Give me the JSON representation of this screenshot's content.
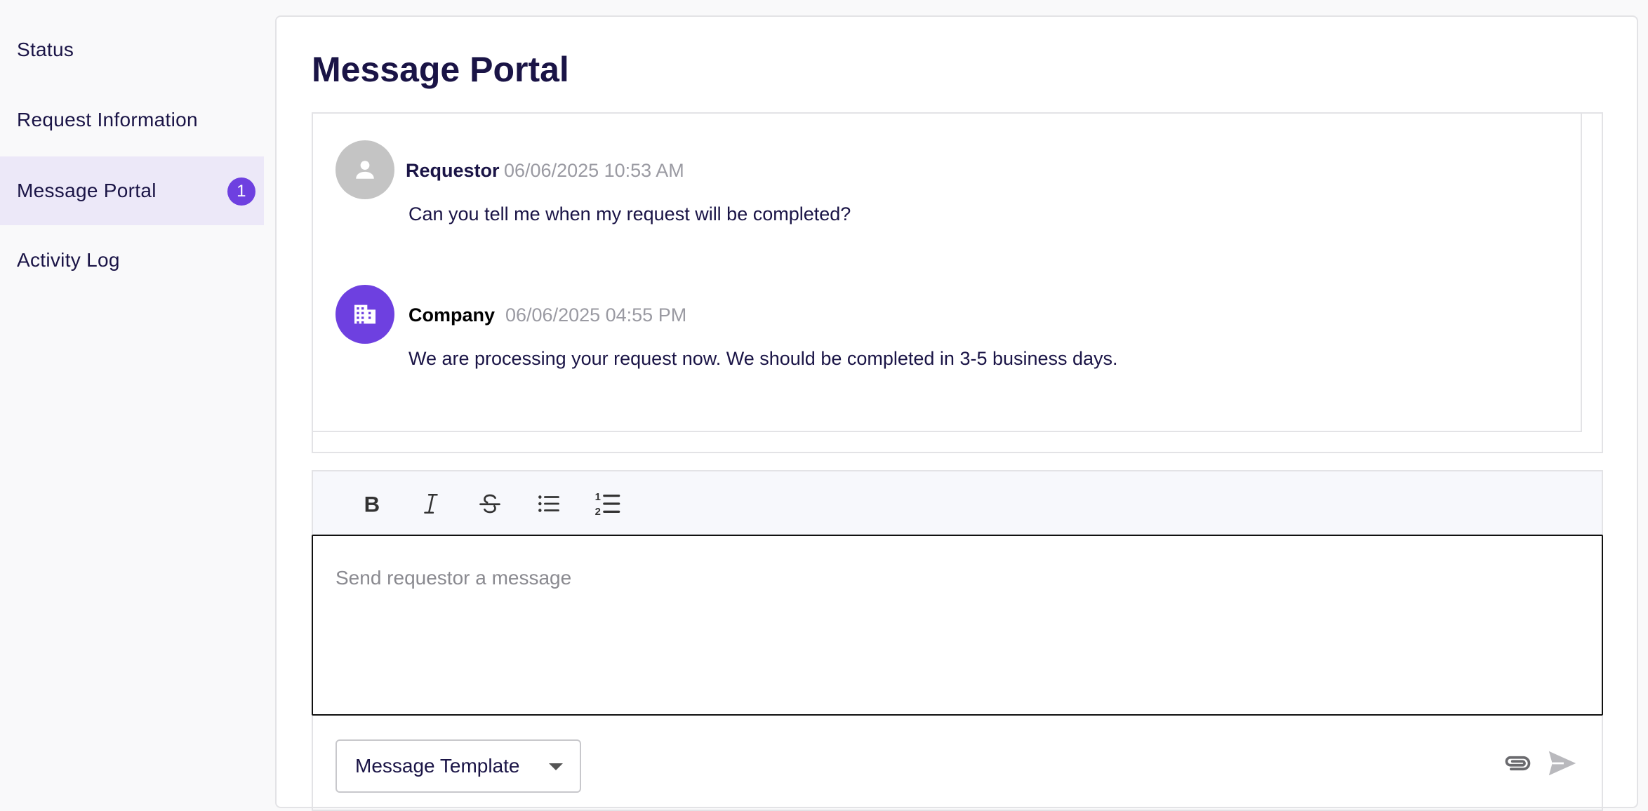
{
  "sidebar": {
    "items": [
      {
        "label": "Status"
      },
      {
        "label": "Request Information"
      },
      {
        "label": "Message Portal",
        "badge": "1"
      },
      {
        "label": "Activity Log"
      }
    ]
  },
  "main": {
    "title": "Message Portal"
  },
  "messages": [
    {
      "author": "Requestor",
      "timestamp": "06/06/2025 10:53 AM",
      "body": "Can you tell me when my request will be completed?",
      "avatar_icon": "person-icon"
    },
    {
      "author": "Company",
      "timestamp": "06/06/2025 04:55 PM",
      "body": "We are processing your request now. We should be completed in 3-5 business days.",
      "avatar_icon": "building-icon"
    }
  ],
  "toolbar": {
    "tools": [
      "bold-icon",
      "italic-icon",
      "strikethrough-icon",
      "bulleted-list-icon",
      "numbered-list-icon"
    ]
  },
  "composer": {
    "placeholder": "Send requestor a message",
    "value": ""
  },
  "template_select": {
    "label": "Message Template"
  },
  "colors": {
    "accent": "#6e40e0",
    "active_nav_bg": "#ece8f8",
    "text": "#1a1446",
    "muted": "#9a9aa2"
  }
}
